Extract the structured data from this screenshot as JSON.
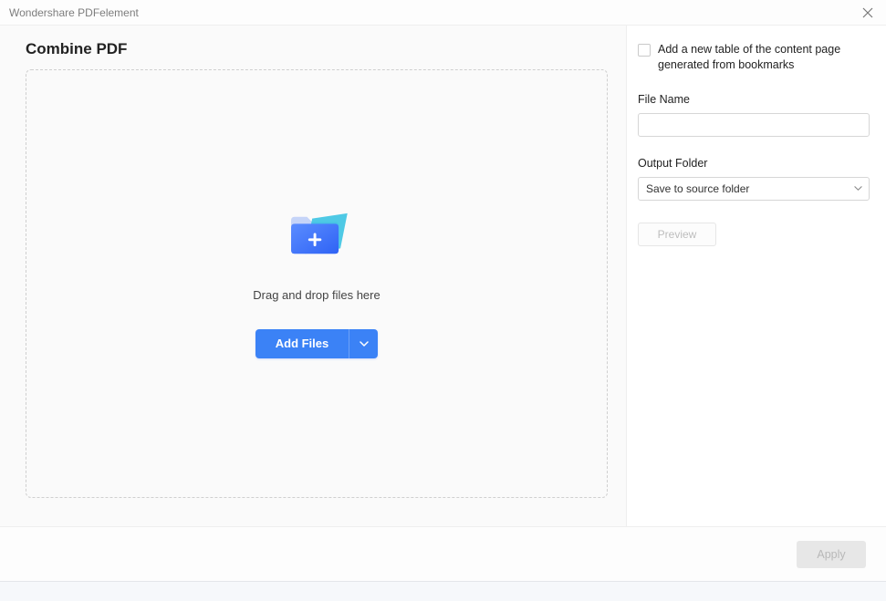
{
  "window": {
    "title": "Wondershare PDFelement"
  },
  "page": {
    "title": "Combine PDF"
  },
  "dropzone": {
    "hint": "Drag and drop files here",
    "add_label": "Add Files"
  },
  "sidebar": {
    "toc_checkbox_label": "Add a new table of the content page generated from bookmarks",
    "filename_label": "File Name",
    "filename_value": "",
    "output_label": "Output Folder",
    "output_selected": "Save to source folder",
    "preview_label": "Preview"
  },
  "footer": {
    "apply_label": "Apply"
  }
}
